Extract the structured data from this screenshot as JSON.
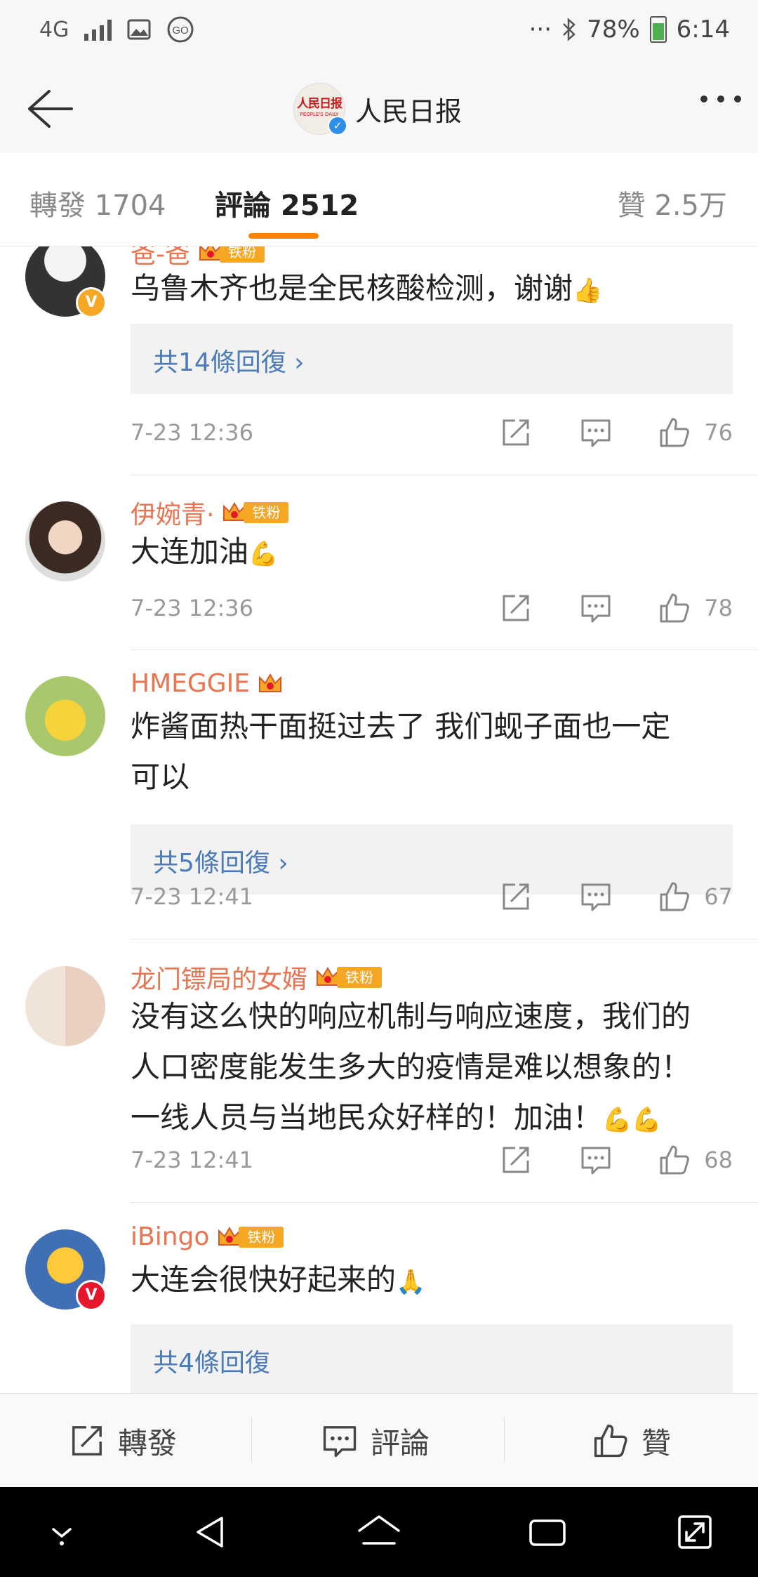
{
  "status_bar": {
    "network": "4G",
    "battery": "78%",
    "time": "6:14",
    "ellipsis": "···"
  },
  "header": {
    "logo_text": "人民日报",
    "logo_subtext": "PEOPLE'S DAILY",
    "title": "人民日报"
  },
  "tabs": {
    "repost": "轉發 1704",
    "comments": "評論 2512",
    "likes": "贊 2.5万"
  },
  "comments": [
    {
      "username": "爸-爸",
      "fan_badge": "铁粉",
      "text": "乌鲁木齐也是全民核酸检测，谢谢",
      "emoji": "👍",
      "replies": "共14條回復 ›",
      "time": "7-23 12:36",
      "likes": "76"
    },
    {
      "username": "伊婉青·",
      "fan_badge": "铁粉",
      "text": "大连加油",
      "emoji": "💪",
      "time": "7-23 12:36",
      "likes": "78"
    },
    {
      "username": "HMEGGIE",
      "text_line1": "炸酱面热干面挺过去了 我们蚬子面也一定",
      "text_line2": "可以",
      "replies": "共5條回復 ›",
      "time": "7-23 12:41",
      "likes": "67"
    },
    {
      "username": "龙门镖局的女婿",
      "fan_badge": "铁粉",
      "text_line1": "没有这么快的响应机制与响应速度，我们的",
      "text_line2": "人口密度能发生多大的疫情是难以想象的！",
      "text_line3": "一线人员与当地民众好样的！加油！",
      "emoji": "💪💪",
      "time": "7-23 12:41",
      "likes": "68"
    },
    {
      "username": "iBingo",
      "fan_badge": "铁粉",
      "text": "大连会很快好起来的",
      "emoji": "🙏",
      "replies": "共4條回復"
    }
  ],
  "bottom_bar": {
    "repost": "轉發",
    "comment": "評論",
    "like": "贊"
  },
  "colors": {
    "accent": "#ff8200",
    "username": "#eb7350",
    "reply_link": "#4b7bb8",
    "fan_badge": "#f5a623",
    "verified_blue": "#2f8ee6",
    "verified_orange": "#f5a623",
    "verified_red": "#e6162d"
  }
}
